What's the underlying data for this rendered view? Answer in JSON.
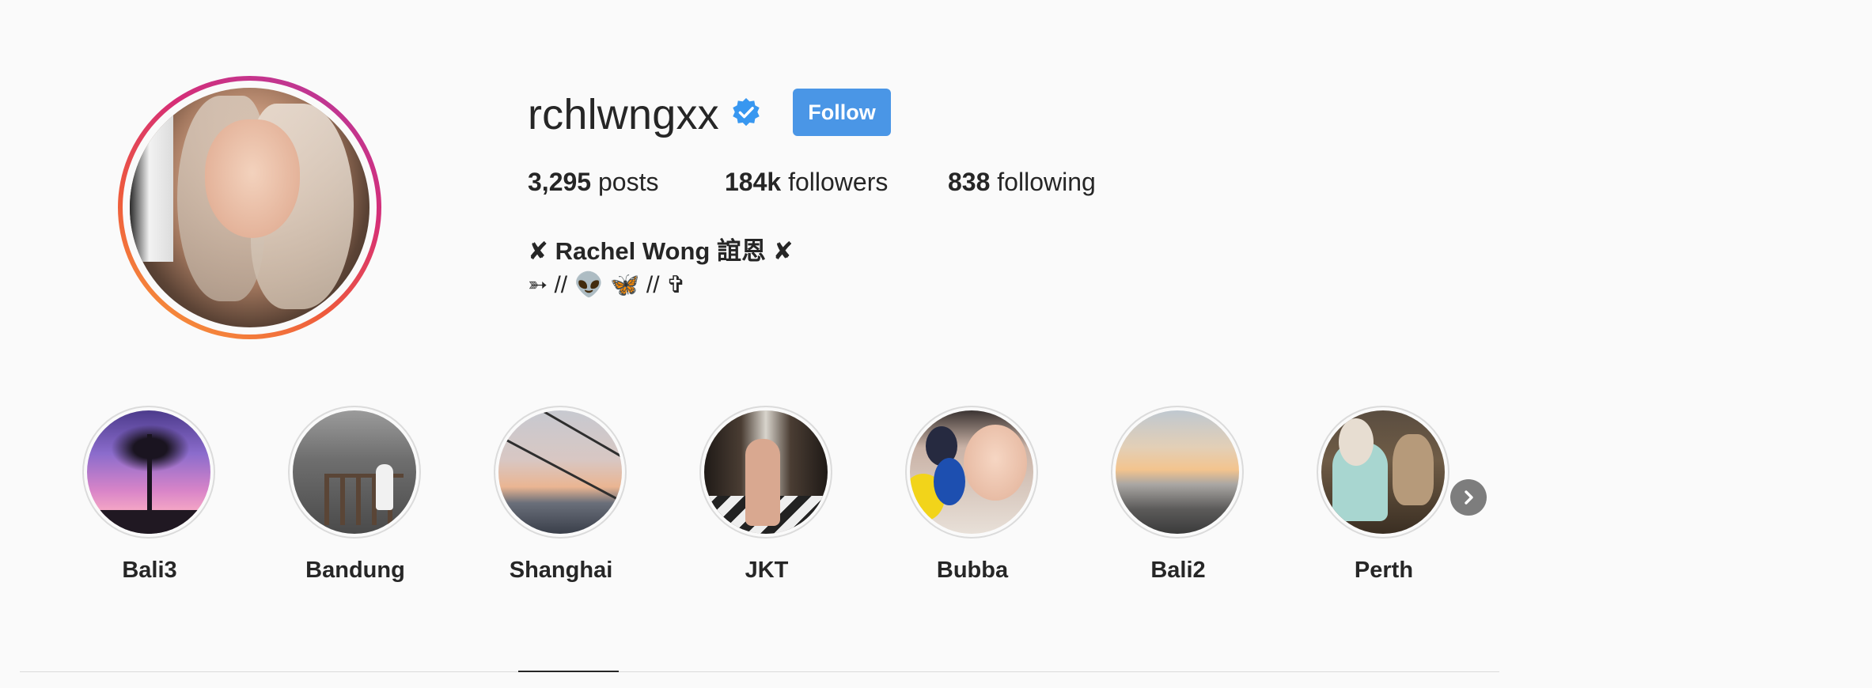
{
  "profile": {
    "username": "rchlwngxx",
    "verified_icon": "verified-badge-icon",
    "follow_label": "Follow",
    "stats": [
      {
        "count": "3,295",
        "label": "posts"
      },
      {
        "count": "184k",
        "label": "followers"
      },
      {
        "count": "838",
        "label": "following"
      }
    ],
    "full_name": "✘ Rachel Wong 誼恩 ✘",
    "bio": "➳ // 👽 🦋  // ✞"
  },
  "highlights": [
    {
      "label": "Bali3"
    },
    {
      "label": "Bandung"
    },
    {
      "label": "Shanghai"
    },
    {
      "label": "JKT"
    },
    {
      "label": "Bubba"
    },
    {
      "label": "Bali2"
    },
    {
      "label": "Perth"
    }
  ],
  "colors": {
    "follow_button": "#4a96e6",
    "verified_badge": "#3897f0",
    "background": "#fafafa",
    "text": "#262626"
  }
}
